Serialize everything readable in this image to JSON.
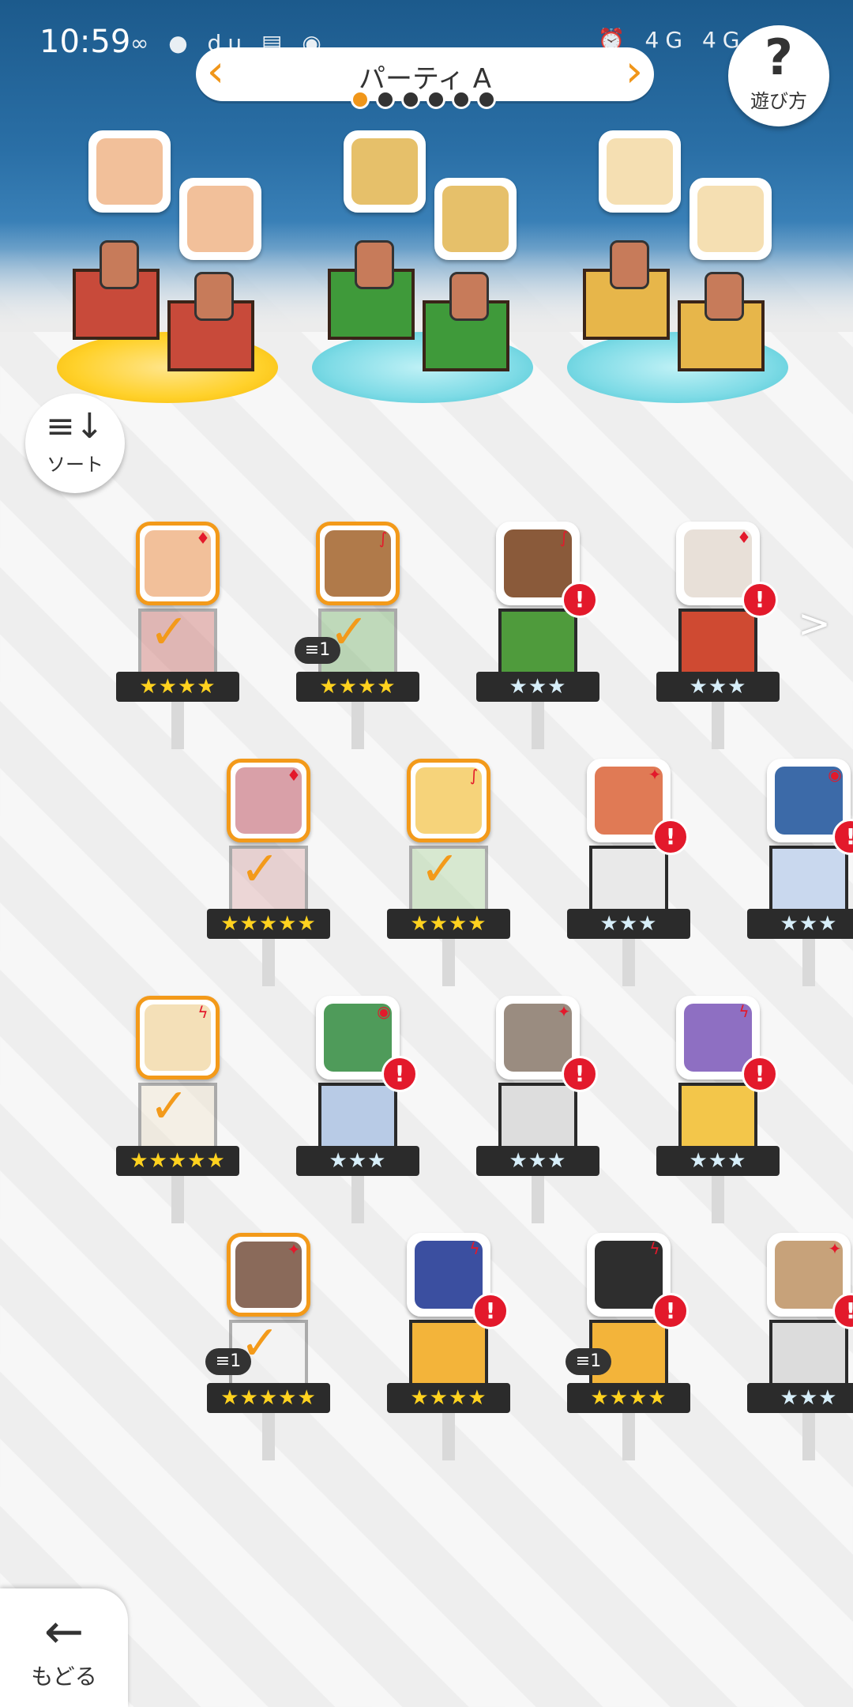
{
  "status_bar": {
    "time": "10:59",
    "left_icons": "∞ ● du ▤ ◉",
    "right_icons": "⏰ 4G 4G HD"
  },
  "party": {
    "title": "パーティ A",
    "prev_icon": "chevron-left-icon",
    "next_icon": "chevron-right-icon",
    "page_count": 6,
    "active_page": 1
  },
  "help": {
    "icon": "?",
    "label": "遊び方"
  },
  "sort": {
    "icon": "≡↓",
    "label": "ソート"
  },
  "back": {
    "icon": "←",
    "label": "もどる"
  },
  "colors": {
    "accent": "#f39a1a",
    "alert": "#e3192b",
    "sky": "#2a6fa6"
  },
  "party_slots": [
    {
      "element": "fire",
      "color": "#c84a3a",
      "base": "gold"
    },
    {
      "element": "wind",
      "color": "#3f9a3a",
      "base": "cyan"
    },
    {
      "element": "light",
      "color": "#e7b64a",
      "base": "cyan"
    }
  ],
  "roster": [
    {
      "row": 1,
      "stars": "★★★★",
      "selected": true,
      "element": "♦",
      "face": "#f2c09a",
      "pillar": "#c4504a",
      "count": ""
    },
    {
      "row": 1,
      "stars": "★★★★",
      "selected": true,
      "element": "∫",
      "face": "#b07a4a",
      "pillar": "#5aa24a",
      "count": "1"
    },
    {
      "row": 1,
      "stars": "★★★",
      "selected": false,
      "element": "∫",
      "face": "#8a5a3a",
      "pillar": "#4f9b3c",
      "count": "",
      "alert": "!"
    },
    {
      "row": 1,
      "stars": "★★★",
      "selected": false,
      "element": "♦",
      "face": "#e8e0d8",
      "pillar": "#cf4a32",
      "count": "",
      "alert": "!"
    },
    {
      "row": 2,
      "stars": "★★★★★",
      "selected": true,
      "element": "♦",
      "face": "#d9a0a8",
      "pillar": "#d89a9a",
      "count": ""
    },
    {
      "row": 2,
      "stars": "★★★★",
      "selected": true,
      "element": "∫",
      "face": "#f6d37a",
      "pillar": "#9ccf8a",
      "count": ""
    },
    {
      "row": 2,
      "stars": "★★★",
      "selected": false,
      "element": "✦",
      "face": "#e07a55",
      "pillar": "#e9e9e9",
      "count": "",
      "alert": "!"
    },
    {
      "row": 2,
      "stars": "★★★",
      "selected": false,
      "element": "◉",
      "face": "#3c6aa8",
      "pillar": "#c9d8ee",
      "count": "",
      "alert": "!"
    },
    {
      "row": 3,
      "stars": "★★★★★",
      "selected": true,
      "element": "ϟ",
      "face": "#f4e0b8",
      "pillar": "#efe2c6",
      "count": ""
    },
    {
      "row": 3,
      "stars": "★★★",
      "selected": false,
      "element": "◉",
      "face": "#4f9b5a",
      "pillar": "#b8cbe6",
      "count": "",
      "alert": "!"
    },
    {
      "row": 3,
      "stars": "★★★",
      "selected": false,
      "element": "✦",
      "face": "#9a8c80",
      "pillar": "#dddddd",
      "count": "",
      "alert": "!"
    },
    {
      "row": 3,
      "stars": "★★★",
      "selected": false,
      "element": "ϟ",
      "face": "#8e6fc2",
      "pillar": "#f3c64a",
      "count": "",
      "alert": "!"
    },
    {
      "row": 4,
      "stars": "★★★★★",
      "selected": true,
      "element": "✦",
      "face": "#8a6a5a",
      "pillar": "#eeeeee",
      "count": "1"
    },
    {
      "row": 4,
      "stars": "★★★★",
      "selected": false,
      "element": "ϟ",
      "face": "#3b4fa0",
      "pillar": "#f3b43a",
      "count": "",
      "alert": "!"
    },
    {
      "row": 4,
      "stars": "★★★★",
      "selected": false,
      "element": "ϟ",
      "face": "#2e2e2e",
      "pillar": "#f3b43a",
      "count": "1",
      "alert": "!"
    },
    {
      "row": 4,
      "stars": "★★★",
      "selected": false,
      "element": "✦",
      "face": "#c7a27a",
      "pillar": "#dcdcdc",
      "count": "",
      "alert": "!"
    }
  ]
}
